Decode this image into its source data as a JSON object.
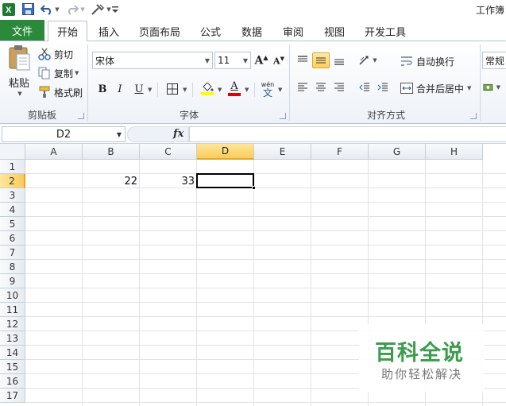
{
  "window": {
    "title": "工作簿"
  },
  "tabs": [
    {
      "label": "文件"
    },
    {
      "label": "开始"
    },
    {
      "label": "插入"
    },
    {
      "label": "页面布局"
    },
    {
      "label": "公式"
    },
    {
      "label": "数据"
    },
    {
      "label": "审阅"
    },
    {
      "label": "视图"
    },
    {
      "label": "开发工具"
    }
  ],
  "clipboard": {
    "paste": "粘贴",
    "cut": "剪切",
    "copy": "复制",
    "format_painter": "格式刷",
    "group_label": "剪贴板"
  },
  "font": {
    "name": "宋体",
    "size": "11",
    "bold": "B",
    "italic": "I",
    "underline": "U",
    "font_color_letter": "A",
    "phonetic_top": "wén",
    "phonetic_bottom": "文",
    "group_label": "字体",
    "highlight_color": "#ffff00",
    "font_color": "#e00000"
  },
  "alignment": {
    "wrap_text": "自动换行",
    "merge_center": "合并后居中",
    "group_label": "对齐方式"
  },
  "number": {
    "format": "常规"
  },
  "formula_bar": {
    "name_box": "D2",
    "fx": "fx",
    "content": ""
  },
  "sheet": {
    "columns": [
      "A",
      "B",
      "C",
      "D",
      "E",
      "F",
      "G",
      "H"
    ],
    "rows": [
      "1",
      "2",
      "3",
      "4",
      "5",
      "6",
      "7",
      "8",
      "9",
      "10",
      "11",
      "12",
      "13",
      "14",
      "15",
      "16",
      "17"
    ],
    "selected_column": "D",
    "selected_row": "2",
    "cells": {
      "B2": "22",
      "C2": "33"
    }
  },
  "watermark": {
    "title": "百科全说",
    "subtitle": "助你轻松解决"
  },
  "colors": {
    "file_tab": "#2a8a3a",
    "accent": "#ffd15c",
    "watermark": "#3a9d4c"
  }
}
